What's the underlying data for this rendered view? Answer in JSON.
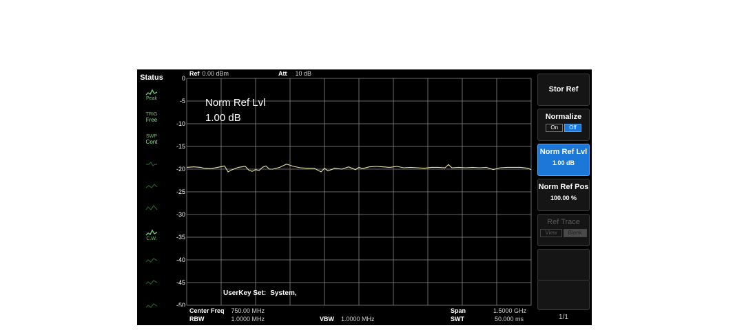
{
  "status": {
    "title": "Status",
    "items": [
      {
        "label": "Peak",
        "icon": "peak-trace-icon"
      },
      {
        "label": "Free",
        "top": "TRIG",
        "icon": "trigger-icon"
      },
      {
        "label": "Cont",
        "top": "SWP",
        "icon": "sweep-icon"
      },
      {
        "label": "",
        "icon": "status-indicator-icon"
      },
      {
        "label": "",
        "icon": "status-indicator-icon"
      },
      {
        "label": "",
        "icon": "status-indicator-icon"
      },
      {
        "label": "C.W.",
        "icon": "cw-trace-icon"
      },
      {
        "label": "",
        "icon": "status-indicator-icon"
      },
      {
        "label": "",
        "icon": "status-indicator-icon"
      },
      {
        "label": "",
        "icon": "status-indicator-icon"
      }
    ]
  },
  "header": {
    "ref_label": "Ref",
    "ref_value": "0.00 dBm",
    "att_label": "Att",
    "att_value": "10 dB"
  },
  "annotation": {
    "line1": "Norm Ref Lvl",
    "line2": "1.00 dB"
  },
  "userkey": {
    "label": "UserKey Set:",
    "value": "System,"
  },
  "bottom": {
    "center_freq_label": "Center Freq",
    "center_freq_value": "750.00 MHz",
    "rbw_label": "RBW",
    "rbw_value": "1.0000 MHz",
    "vbw_label": "VBW",
    "vbw_value": "1.0000 MHz",
    "span_label": "Span",
    "span_value": "1.5000 GHz",
    "swt_label": "SWT",
    "swt_value": "50.000 ms"
  },
  "softkeys": {
    "stor_ref": "Stor Ref",
    "normalize": "Normalize",
    "normalize_on": "On",
    "normalize_off": "Off",
    "norm_ref_lvl": "Norm Ref Lvl",
    "norm_ref_lvl_value": "1.00 dB",
    "norm_ref_pos": "Norm Ref Pos",
    "norm_ref_pos_value": "100.00 %",
    "ref_trace": "Ref Trace",
    "ref_trace_view": "View",
    "ref_trace_blank": "Blank",
    "page": "1/1"
  },
  "colors": {
    "background": "#000000",
    "grid": "#8a8a8a",
    "trace": "#e8e6a0",
    "selected_softkey": "#1b78d8",
    "status_text": "#6fc46f"
  },
  "chart_data": {
    "type": "line",
    "y_ticks": [
      "0",
      "-5",
      "-10",
      "-15",
      "-20",
      "-25",
      "-30",
      "-35",
      "-40",
      "-45",
      "-50"
    ],
    "ylim": [
      -50,
      0
    ],
    "xlim": [
      0,
      1500
    ],
    "grid": true,
    "series": [
      {
        "x": [
          0,
          30,
          60,
          75,
          105,
          135,
          165,
          180,
          195,
          225,
          255,
          270,
          285,
          300,
          315,
          330,
          345,
          360,
          375,
          405,
          435,
          465,
          495,
          525,
          555,
          585,
          600,
          615,
          645,
          675,
          705,
          735,
          750,
          765,
          795,
          825,
          855,
          885,
          915,
          945,
          975,
          1005,
          1035,
          1065,
          1095,
          1125,
          1140,
          1155,
          1185,
          1215,
          1245,
          1275,
          1305,
          1335,
          1365,
          1395,
          1425,
          1455,
          1485,
          1500
        ],
        "y": [
          -19.6,
          -19.5,
          -19.6,
          -19.8,
          -19.9,
          -19.6,
          -19.3,
          -20.6,
          -20.2,
          -19.6,
          -19.4,
          -20.2,
          -20.5,
          -20.1,
          -20.3,
          -19.6,
          -19.3,
          -20.0,
          -20.0,
          -19.6,
          -18.9,
          -19.4,
          -19.7,
          -19.8,
          -19.8,
          -20.6,
          -19.8,
          -20.4,
          -19.8,
          -20.0,
          -19.5,
          -20.1,
          -19.6,
          -19.9,
          -19.5,
          -19.4,
          -19.5,
          -19.6,
          -19.4,
          -19.7,
          -19.6,
          -19.7,
          -19.8,
          -19.6,
          -19.6,
          -19.7,
          -19.0,
          -19.7,
          -19.6,
          -19.7,
          -19.6,
          -19.7,
          -19.6,
          -20.1,
          -19.7,
          -19.6,
          -19.6,
          -19.6,
          -19.8,
          -20.1
        ]
      }
    ]
  }
}
